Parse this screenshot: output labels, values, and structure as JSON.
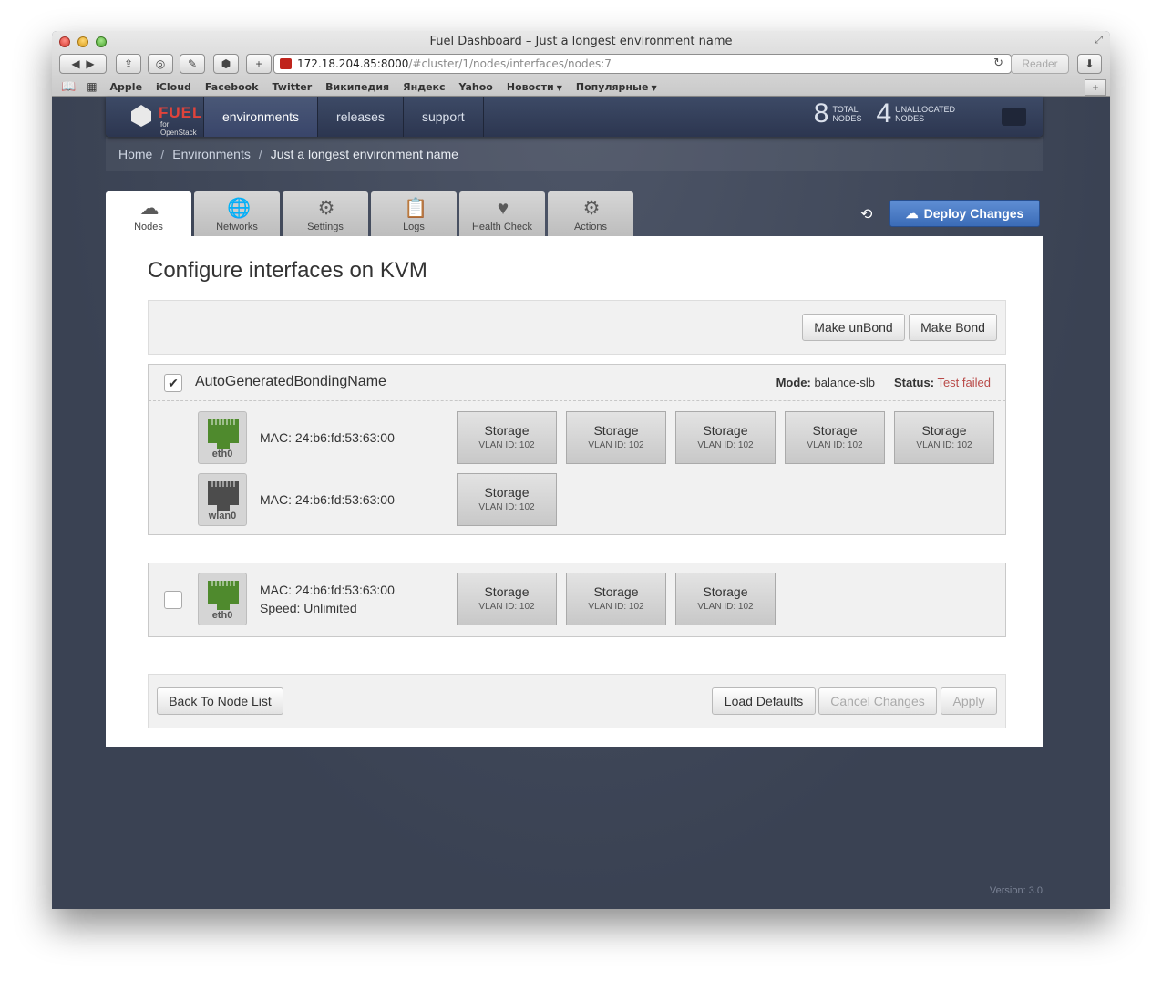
{
  "browser": {
    "window_title": "Fuel Dashboard – Just a longest environment name",
    "url_host": "172.18.204.85:8000",
    "url_path": "/#cluster/1/nodes/interfaces/nodes:7",
    "reader_label": "Reader",
    "bookmarks": [
      "Apple",
      "iCloud",
      "Facebook",
      "Twitter",
      "Википедия",
      "Яндекс",
      "Yahoo",
      "Новости",
      "Популярные"
    ]
  },
  "navbar": {
    "logo_text": "FUEL",
    "logo_sub": "for OpenStack",
    "items": [
      "environments",
      "releases",
      "support"
    ],
    "total_nodes": "8",
    "total_label_1": "TOTAL",
    "total_label_2": "NODES",
    "unallocated_nodes": "4",
    "unallocated_label_1": "UNALLOCATED",
    "unallocated_label_2": "NODES"
  },
  "breadcrumb": {
    "home": "Home",
    "environments": "Environments",
    "current": "Just a longest environment name",
    "separator": "/"
  },
  "tabs": [
    "Nodes",
    "Networks",
    "Settings",
    "Logs",
    "Health Check",
    "Actions"
  ],
  "deploy_label": "Deploy Changes",
  "page": {
    "title": "Configure interfaces on KVM",
    "unbond_label": "Make unBond",
    "bond_label": "Make Bond"
  },
  "bond": {
    "name": "AutoGeneratedBondingName",
    "mode_label": "Mode:",
    "mode_value": "balance-slb",
    "status_label": "Status:",
    "status_value": "Test failed",
    "checked": true,
    "nics": [
      {
        "name": "eth0",
        "mac": "MAC: 24:b6:fd:53:63:00"
      },
      {
        "name": "wlan0",
        "mac": "MAC: 24:b6:fd:53:63:00"
      }
    ]
  },
  "iface2": {
    "name": "eth0",
    "mac": "MAC: 24:b6:fd:53:63:00",
    "speed": "Speed: Unlimited",
    "checked": false
  },
  "network": {
    "name": "Storage",
    "vlan": "VLAN ID: 102"
  },
  "footer": {
    "back_label": "Back To Node List",
    "load_defaults_label": "Load Defaults",
    "cancel_label": "Cancel Changes",
    "apply_label": "Apply",
    "version": "Version: 3.0"
  }
}
